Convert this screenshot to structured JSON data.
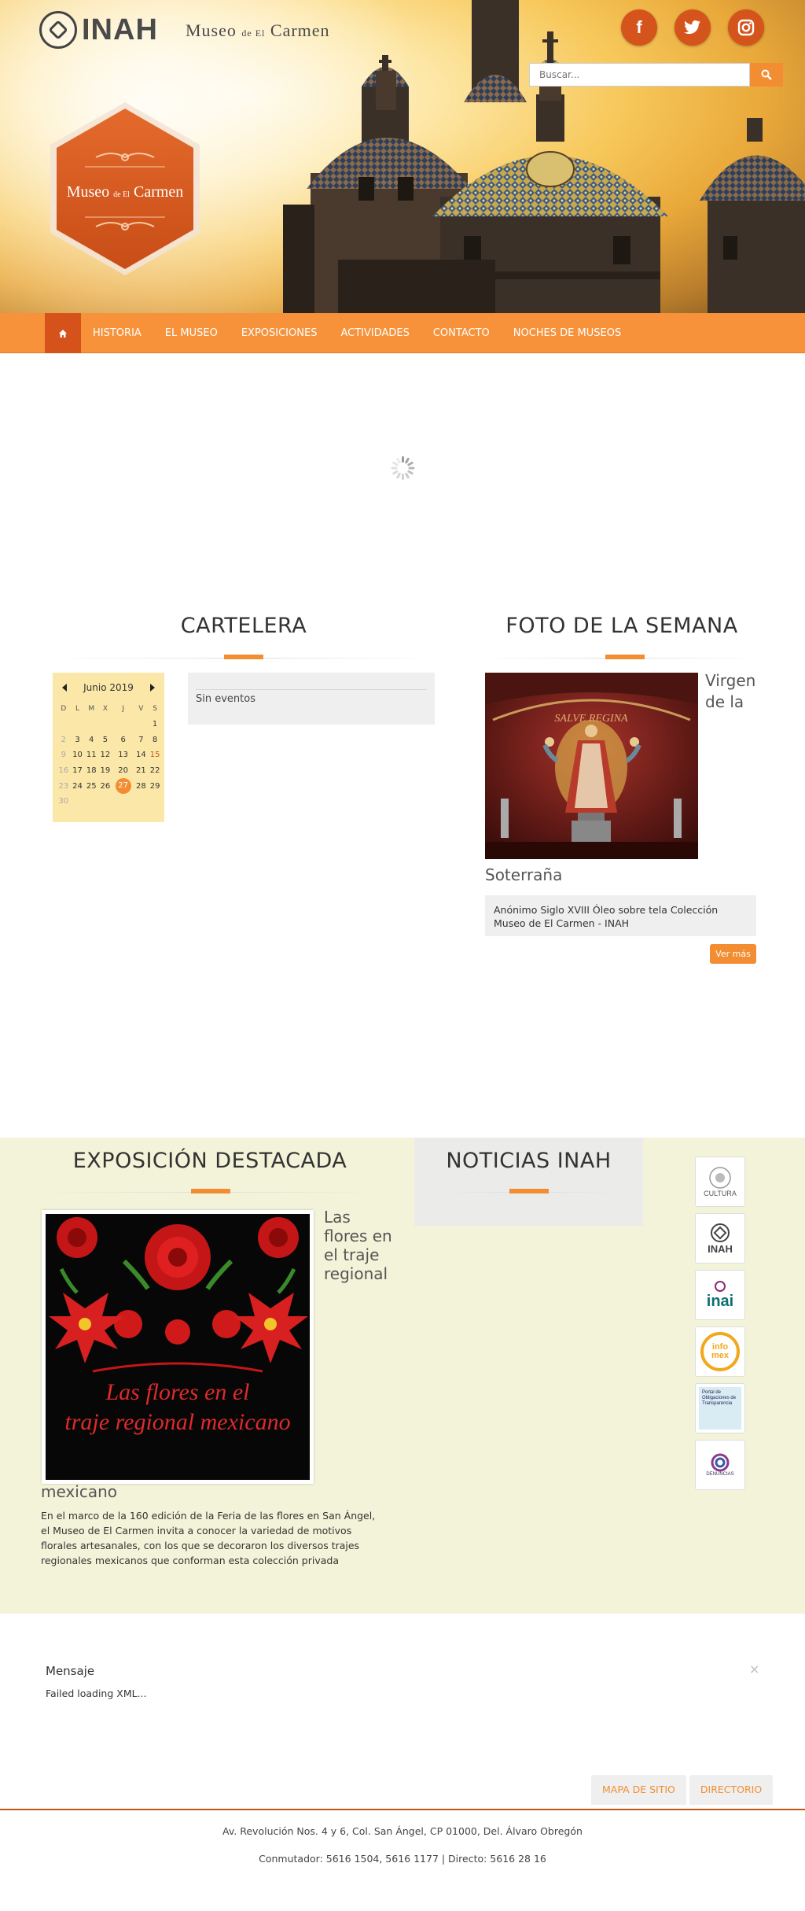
{
  "header": {
    "inah_logo": "INAH",
    "museo_logo": {
      "main1": "Museo",
      "small": "de El",
      "main2": "Carmen"
    },
    "hex_logo": {
      "main1": "Museo",
      "small": "de El",
      "main2": "Carmen"
    },
    "social": [
      {
        "name": "facebook-icon",
        "glyph": "f"
      },
      {
        "name": "twitter-icon",
        "glyph": "t"
      },
      {
        "name": "instagram-icon",
        "glyph": "◎"
      }
    ],
    "search": {
      "placeholder": "Buscar..."
    }
  },
  "nav": {
    "home_icon": "home-icon",
    "items": [
      "HISTORIA",
      "EL MUSEO",
      "EXPOSICIONES",
      "ACTIVIDADES",
      "CONTACTO",
      "NOCHES DE MUSEOS"
    ]
  },
  "cartelera": {
    "title": "CARTELERA",
    "calendar": {
      "month": "Junio 2019",
      "weekdays": [
        "D",
        "L",
        "M",
        "X",
        "J",
        "V",
        "S"
      ],
      "weeks": [
        [
          "",
          "",
          "",
          "",
          "",
          "",
          "1"
        ],
        [
          "2",
          "3",
          "4",
          "5",
          "6",
          "7",
          "8"
        ],
        [
          "9",
          "10",
          "11",
          "12",
          "13",
          "14",
          "15"
        ],
        [
          "16",
          "17",
          "18",
          "19",
          "20",
          "21",
          "22"
        ],
        [
          "23",
          "24",
          "25",
          "26",
          "27",
          "28",
          "29"
        ],
        [
          "30",
          "",
          "",
          "",
          "",
          "",
          ""
        ]
      ],
      "today": "27"
    },
    "events_text": "Sin eventos"
  },
  "foto": {
    "title": "FOTO DE LA SEMANA",
    "caption_title_a": "Virgen de la",
    "caption_title_b": "Soterraña",
    "description": "Anónimo Siglo XVIII Óleo sobre tela Colección Museo de El Carmen - INAH",
    "image_text": "SALVE REGINA",
    "more_label": "Ver más"
  },
  "expo": {
    "title": "EXPOSICIÓN DESTACADA",
    "caption_title_a": "Las flores en el traje regional",
    "caption_title_b": "mexicano",
    "image_text": "Las flores en el traje regional mexicano",
    "description": "En el marco de la 160 edición de la Feria de las flores en San Ángel, el Museo de El Carmen invita a conocer la variedad de motivos florales artesanales, con los que se decoraron los diversos trajes regionales mexicanos que conforman esta colección privada"
  },
  "noticias": {
    "title": "NOTICIAS INAH"
  },
  "side_logos": [
    {
      "name": "cultura-logo",
      "label": "CULTURA"
    },
    {
      "name": "inah-logo",
      "label": "INAH"
    },
    {
      "name": "inai-logo",
      "label": "inai"
    },
    {
      "name": "infomex-logo",
      "label": "info mex"
    },
    {
      "name": "transparencia-logo",
      "label": "Portal de Obligaciones de Transparencia"
    },
    {
      "name": "denuncias-logo",
      "label": "DENUNCIAS"
    }
  ],
  "mensaje": {
    "title": "Mensaje",
    "close": "×",
    "text": "Failed loading XML..."
  },
  "footer": {
    "buttons": [
      "MAPA DE SITIO",
      "DIRECTORIO"
    ],
    "address": "Av. Revolución Nos. 4 y 6, Col. San Ángel, CP 01000, Del. Álvaro Obregón",
    "phones": "Conmutador: 5616 1504, 5616 1177 | Directo: 5616 28 16"
  },
  "colors": {
    "accent": "#f28d31",
    "accent_dark": "#d5531b",
    "nav": "#f7923a",
    "cream": "#f3f3d9",
    "calendar": "#fbe8a8"
  }
}
